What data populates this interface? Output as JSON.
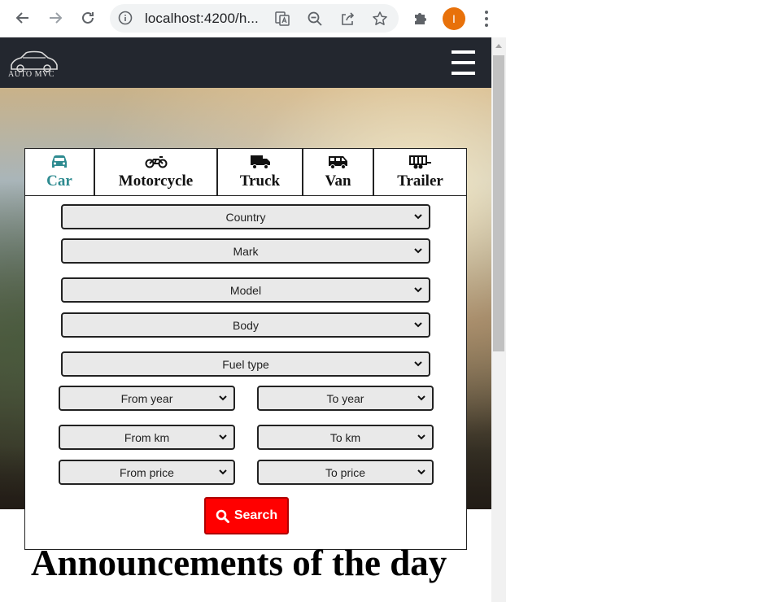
{
  "browser": {
    "url": "localhost:4200/h...",
    "profile_initial": "I"
  },
  "site": {
    "logo_text": "AUTO MVC"
  },
  "tabs": [
    {
      "label": "Car",
      "icon": "car-icon",
      "active": true
    },
    {
      "label": "Motorcycle",
      "icon": "motorcycle-icon",
      "active": false
    },
    {
      "label": "Truck",
      "icon": "truck-icon",
      "active": false
    },
    {
      "label": "Van",
      "icon": "van-icon",
      "active": false
    },
    {
      "label": "Trailer",
      "icon": "trailer-icon",
      "active": false
    }
  ],
  "filters": {
    "country": "Country",
    "mark": "Mark",
    "model": "Model",
    "body": "Body",
    "fuel_type": "Fuel type",
    "from_year": "From year",
    "to_year": "To year",
    "from_km": "From km",
    "to_km": "To km",
    "from_price": "From price",
    "to_price": "To price"
  },
  "search_button": "Search",
  "announcements_title": "Announcements of the day",
  "colors": {
    "active_tab": "#2e8b90",
    "search_button": "#ff0000",
    "navbar": "#23272f",
    "profile": "#e8710a"
  }
}
